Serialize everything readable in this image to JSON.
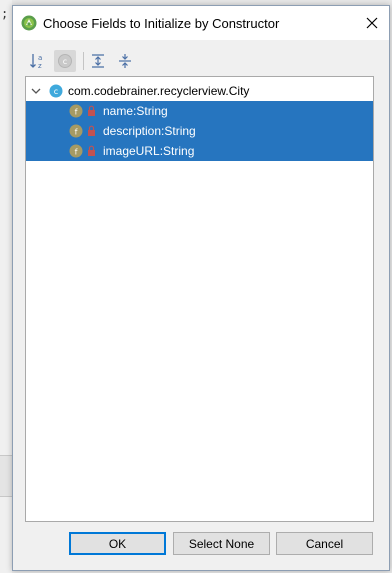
{
  "background": {
    "fragment_text": ";"
  },
  "dialog": {
    "title": "Choose Fields to Initialize by Constructor",
    "toolbar": {
      "sort_icon": "sort-alphabetically-icon",
      "class_icon": "show-classes-icon",
      "expand_icon": "expand-all-icon",
      "collapse_icon": "collapse-all-icon"
    },
    "tree": {
      "root": {
        "icon_letter": "c",
        "label": "com.codebrainer.recyclerview.City",
        "expanded": true
      },
      "fields": [
        {
          "icon_letter": "f",
          "label": "name:String",
          "selected": true
        },
        {
          "icon_letter": "f",
          "label": "description:String",
          "selected": true
        },
        {
          "icon_letter": "f",
          "label": "imageURL:String",
          "selected": true
        }
      ]
    },
    "buttons": {
      "ok": "OK",
      "select_none": "Select None",
      "cancel": "Cancel"
    }
  },
  "colors": {
    "selection": "#2675bf",
    "default_button_border": "#0078d7",
    "class_icon": "#3fa9dc",
    "field_icon": "#a69a63",
    "lock": "#c15252"
  }
}
